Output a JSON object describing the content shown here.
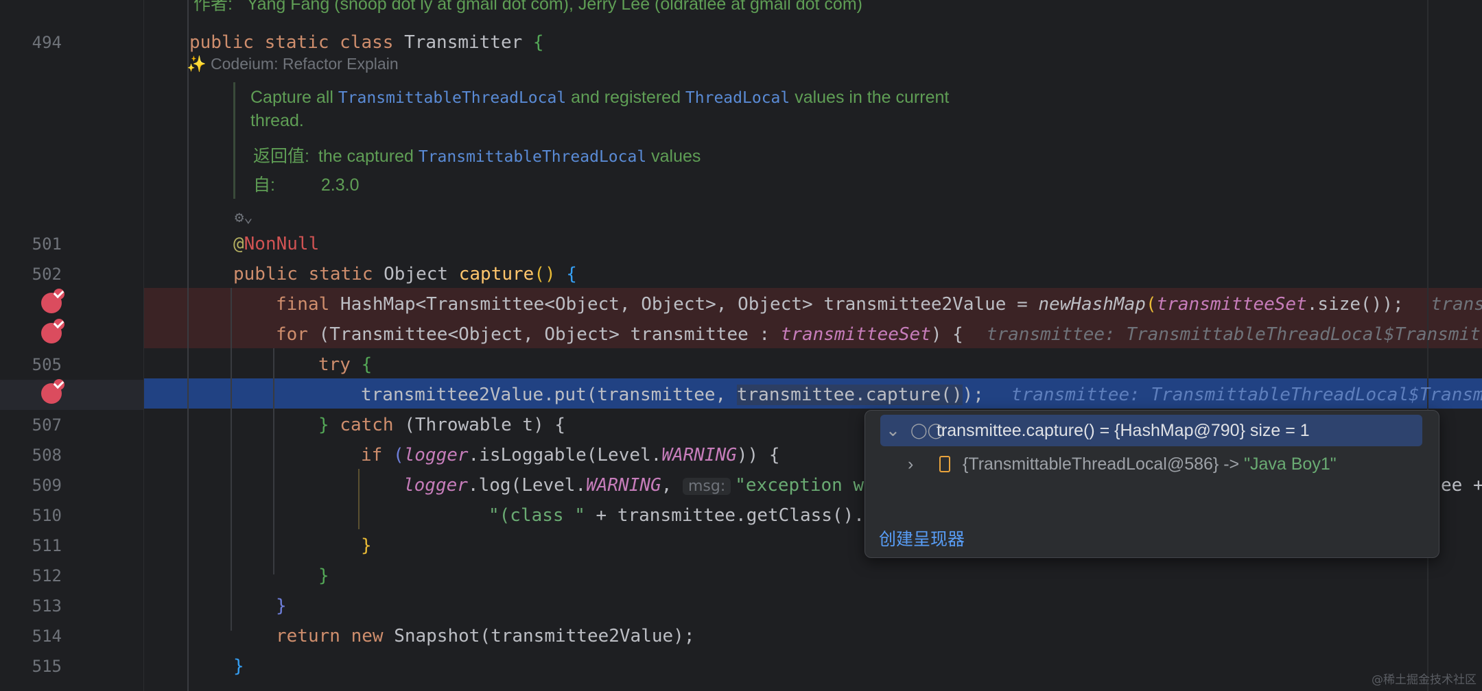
{
  "line_numbers": {
    "l494": "494",
    "l501": "501",
    "l502": "502",
    "l505": "505",
    "l507": "507",
    "l508": "508",
    "l509": "509",
    "l510": "510",
    "l511": "511",
    "l512": "512",
    "l513": "513",
    "l514": "514",
    "l515": "515"
  },
  "top_comment": "作者:   Yang Fang (snoop dot ly at gmail dot com), Jerry Lee (oldratlee at gmail dot com)",
  "code": {
    "class_kw": "public static class ",
    "class_name": "Transmitter",
    "class_brace": " {",
    "annotation_at": "@",
    "annotation_name": "NonNull",
    "method_mods": "public static ",
    "method_ret": "Object ",
    "method_name": "capture",
    "l503_final": "final ",
    "l503_type": "HashMap<Transmittee<Object, Object>, Object> transmittee2Value = ",
    "l503_call": "newHashMap",
    "l503_field": "transmitteeSet",
    "l503_tail": ".size());",
    "l503_hint": "transm",
    "l504_for": "for ",
    "l504_body": "(Transmittee<Object, Object> transmittee : ",
    "l504_field": "transmitteeSet",
    "l504_close": ") {",
    "l504_hint": "transmittee: TransmittableThreadLocal$Transmit",
    "l505_try": "try ",
    "l506_a": "transmittee2Value.put(transmittee, ",
    "l506_b": "transmittee.capture()",
    "l506_c": ");",
    "l506_hint": "transmittee: TransmittableThreadLocal$Transm",
    "l507_a": "} ",
    "l507_catch": "catch ",
    "l507_b": "(Throwable t) {",
    "l508_if": "if ",
    "l508_logger": "logger",
    "l508_a": ".isLoggable(Level.",
    "l508_warning": "WARNING",
    "l508_b": ")) {",
    "l509_logger": "logger",
    "l509_a": ".log(Level.",
    "l509_warning": "WARNING",
    "l509_comma": ", ",
    "l509_pill": "msg:",
    "l509_str": "\"exception w",
    "l509_tail": "ee +",
    "l510_str": "\"(class \"",
    "l510_a": " + transmittee.getClass().",
    "l511": "}",
    "l512": "}",
    "l513": "}",
    "l514_ret": "return new ",
    "l514_a": "Snapshot(transmittee2Value);",
    "l515": "}"
  },
  "codeium_lens": {
    "sparkle": "✨",
    "label": "Codeium: Refactor Explain"
  },
  "doc": {
    "p1_a": "Capture all ",
    "p1_link1": "TransmittableThreadLocal",
    "p1_b": " and registered ",
    "p1_link2": "ThreadLocal",
    "p1_c": " values in the current",
    "p1_d": "thread.",
    "returns_label": "返回值:",
    "returns_a": "the captured ",
    "returns_link": "TransmittableThreadLocal",
    "returns_b": " values",
    "since_label": "自:",
    "since_value": "2.3.0"
  },
  "popup": {
    "expr": "transmittee.capture() = {HashMap@790}  size = 1",
    "entry_key": "{TransmittableThreadLocal@586} -> ",
    "entry_value": "\"Java Boy1\"",
    "create_renderer": "创建呈现器"
  },
  "watermark": "@稀土掘金技术社区",
  "colors": {
    "breakpoint": "#db4c5e",
    "execution_line": "#214283",
    "breakpoint_line": "#3b2325",
    "keyword": "#cf8e6d"
  }
}
